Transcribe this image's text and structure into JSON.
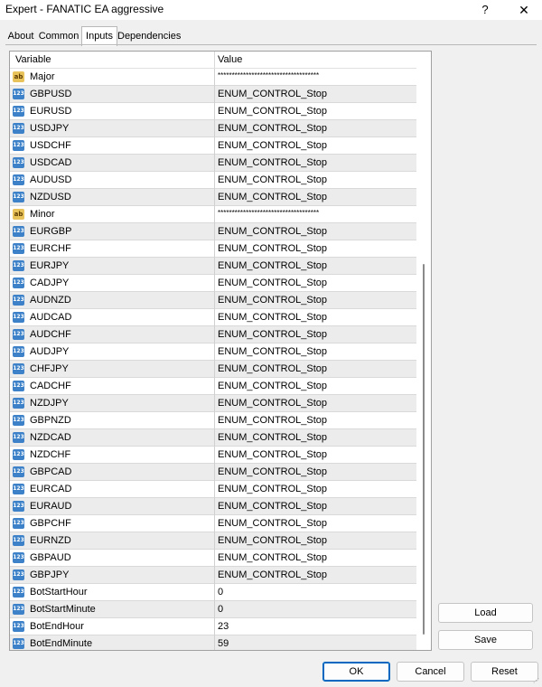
{
  "window": {
    "title": "Expert - FANATIC EA aggressive",
    "help_label": "?",
    "close_label": "✕"
  },
  "tabs": [
    {
      "label": "About"
    },
    {
      "label": "Common"
    },
    {
      "label": "Inputs"
    },
    {
      "label": "Dependencies"
    }
  ],
  "table": {
    "columns": [
      "Variable",
      "Value"
    ],
    "rows": [
      {
        "name": "Major",
        "value": "************************************",
        "type": "ab"
      },
      {
        "name": "GBPUSD",
        "value": "ENUM_CONTROL_Stop",
        "type": "123"
      },
      {
        "name": "EURUSD",
        "value": "ENUM_CONTROL_Stop",
        "type": "123"
      },
      {
        "name": "USDJPY",
        "value": "ENUM_CONTROL_Stop",
        "type": "123"
      },
      {
        "name": "USDCHF",
        "value": "ENUM_CONTROL_Stop",
        "type": "123"
      },
      {
        "name": "USDCAD",
        "value": "ENUM_CONTROL_Stop",
        "type": "123"
      },
      {
        "name": "AUDUSD",
        "value": "ENUM_CONTROL_Stop",
        "type": "123"
      },
      {
        "name": "NZDUSD",
        "value": "ENUM_CONTROL_Stop",
        "type": "123"
      },
      {
        "name": "Minor",
        "value": "************************************",
        "type": "ab"
      },
      {
        "name": "EURGBP",
        "value": "ENUM_CONTROL_Stop",
        "type": "123"
      },
      {
        "name": "EURCHF",
        "value": "ENUM_CONTROL_Stop",
        "type": "123"
      },
      {
        "name": "EURJPY",
        "value": "ENUM_CONTROL_Stop",
        "type": "123"
      },
      {
        "name": "CADJPY",
        "value": "ENUM_CONTROL_Stop",
        "type": "123"
      },
      {
        "name": "AUDNZD",
        "value": "ENUM_CONTROL_Stop",
        "type": "123"
      },
      {
        "name": "AUDCAD",
        "value": "ENUM_CONTROL_Stop",
        "type": "123"
      },
      {
        "name": "AUDCHF",
        "value": "ENUM_CONTROL_Stop",
        "type": "123"
      },
      {
        "name": "AUDJPY",
        "value": "ENUM_CONTROL_Stop",
        "type": "123"
      },
      {
        "name": "CHFJPY",
        "value": "ENUM_CONTROL_Stop",
        "type": "123"
      },
      {
        "name": "CADCHF",
        "value": "ENUM_CONTROL_Stop",
        "type": "123"
      },
      {
        "name": "NZDJPY",
        "value": "ENUM_CONTROL_Stop",
        "type": "123"
      },
      {
        "name": "GBPNZD",
        "value": "ENUM_CONTROL_Stop",
        "type": "123"
      },
      {
        "name": "NZDCAD",
        "value": "ENUM_CONTROL_Stop",
        "type": "123"
      },
      {
        "name": "NZDCHF",
        "value": "ENUM_CONTROL_Stop",
        "type": "123"
      },
      {
        "name": "GBPCAD",
        "value": "ENUM_CONTROL_Stop",
        "type": "123"
      },
      {
        "name": "EURCAD",
        "value": "ENUM_CONTROL_Stop",
        "type": "123"
      },
      {
        "name": "EURAUD",
        "value": "ENUM_CONTROL_Stop",
        "type": "123"
      },
      {
        "name": "GBPCHF",
        "value": "ENUM_CONTROL_Stop",
        "type": "123"
      },
      {
        "name": "EURNZD",
        "value": "ENUM_CONTROL_Stop",
        "type": "123"
      },
      {
        "name": "GBPAUD",
        "value": "ENUM_CONTROL_Stop",
        "type": "123"
      },
      {
        "name": "GBPJPY",
        "value": "ENUM_CONTROL_Stop",
        "type": "123"
      },
      {
        "name": "BotStartHour",
        "value": "0",
        "type": "123"
      },
      {
        "name": "BotStartMinute",
        "value": "0",
        "type": "123"
      },
      {
        "name": "BotEndHour",
        "value": "23",
        "type": "123"
      },
      {
        "name": "BotEndMinute",
        "value": "59",
        "type": "123"
      }
    ]
  },
  "buttons": {
    "load": "Load",
    "save": "Save",
    "ok": "OK",
    "cancel": "Cancel",
    "reset": "Reset"
  },
  "colors": {
    "accent": "#0067c0",
    "int_icon": "#3d82c8",
    "string_icon": "#e8c25a"
  }
}
